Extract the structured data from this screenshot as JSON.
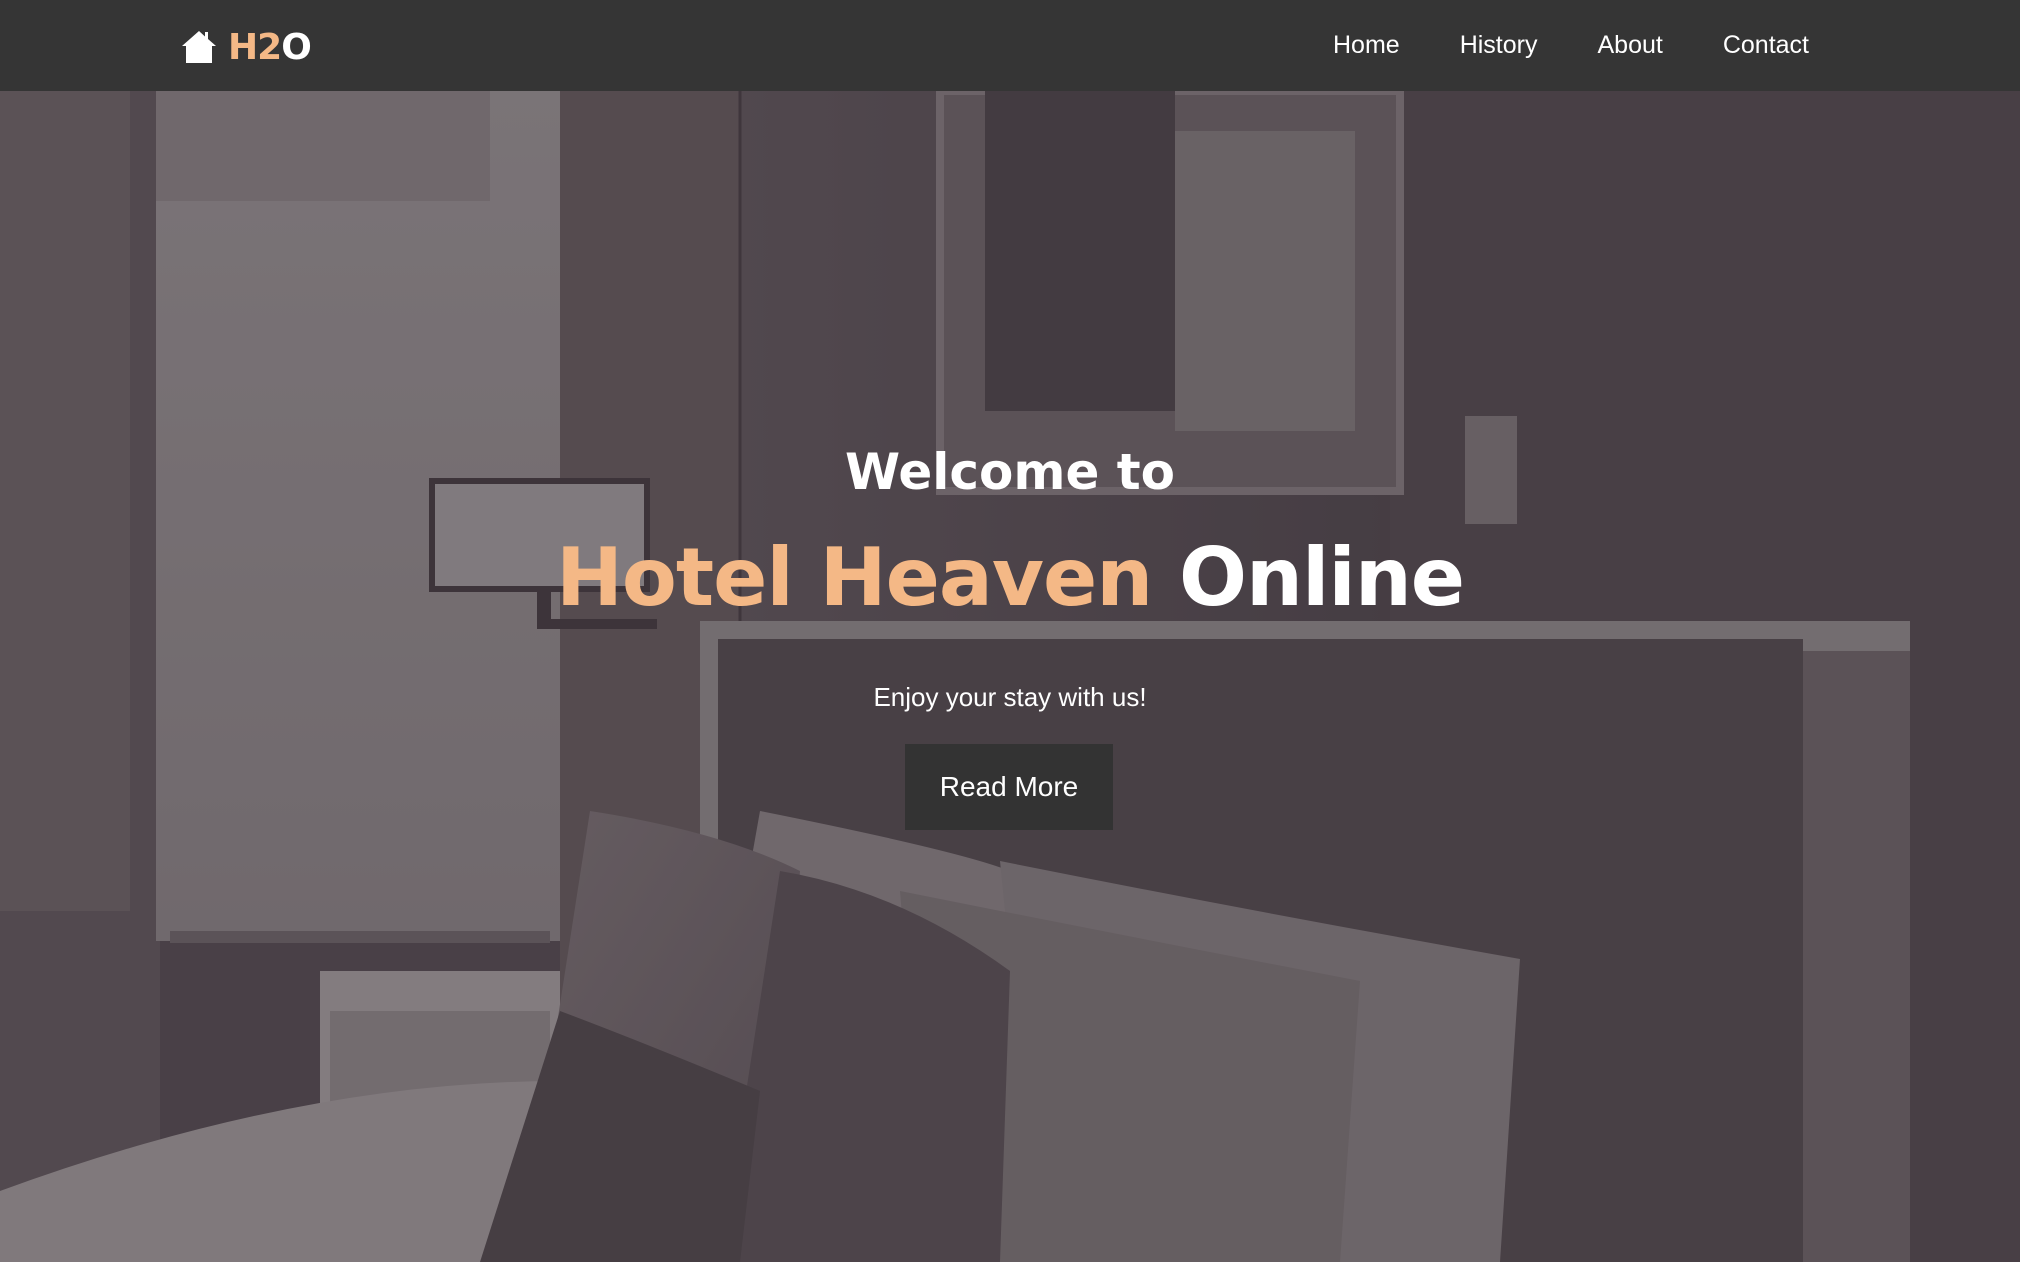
{
  "nav": {
    "brand": {
      "part1": "H2",
      "part2": "O",
      "icon": "home-icon"
    },
    "links": [
      "Home",
      "History",
      "About",
      "Contact"
    ]
  },
  "hero": {
    "welcome": "Welcome to",
    "title_accent": "Hotel Heaven",
    "title_rest": " Online",
    "tagline": "Enjoy your stay with us!",
    "button_label": "Read More"
  },
  "colors": {
    "navbar": "#353535",
    "accent": "#f4b886",
    "button": "#333333",
    "overlay": "#4a4148"
  }
}
